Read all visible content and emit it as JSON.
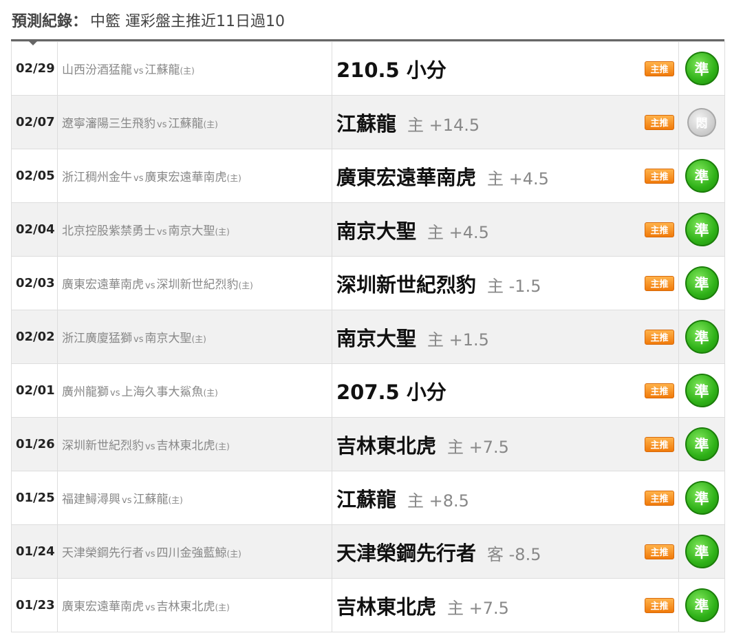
{
  "header": {
    "label": "預測紀錄",
    "colon": "：",
    "title": "中籃 運彩盤主推近11日過10"
  },
  "rows": [
    {
      "date": "02/29",
      "away": "山西汾酒猛龍",
      "vs": "vs",
      "home": "江蘇龍",
      "home_tag": "(主)",
      "pick": "210.5 小分",
      "spread": "",
      "badge": "主推",
      "result": "準",
      "result_type": "win"
    },
    {
      "date": "02/07",
      "away": "遼寧瀋陽三生飛豹",
      "vs": "vs",
      "home": "江蘇龍",
      "home_tag": "(主)",
      "pick": "江蘇龍",
      "spread": "主 +14.5",
      "badge": "主推",
      "result": "悶",
      "result_type": "push"
    },
    {
      "date": "02/05",
      "away": "浙江稠州金牛",
      "vs": "vs",
      "home": "廣東宏遠華南虎",
      "home_tag": "(主)",
      "pick": "廣東宏遠華南虎",
      "spread": "主 +4.5",
      "badge": "主推",
      "result": "準",
      "result_type": "win"
    },
    {
      "date": "02/04",
      "away": "北京控股紫禁勇士",
      "vs": "vs",
      "home": "南京大聖",
      "home_tag": "(主)",
      "pick": "南京大聖",
      "spread": "主 +4.5",
      "badge": "主推",
      "result": "準",
      "result_type": "win"
    },
    {
      "date": "02/03",
      "away": "廣東宏遠華南虎",
      "vs": "vs",
      "home": "深圳新世紀烈豹",
      "home_tag": "(主)",
      "pick": "深圳新世紀烈豹",
      "spread": "主 -1.5",
      "badge": "主推",
      "result": "準",
      "result_type": "win"
    },
    {
      "date": "02/02",
      "away": "浙江廣廈猛獅",
      "vs": "vs",
      "home": "南京大聖",
      "home_tag": "(主)",
      "pick": "南京大聖",
      "spread": "主 +1.5",
      "badge": "主推",
      "result": "準",
      "result_type": "win"
    },
    {
      "date": "02/01",
      "away": "廣州龍獅",
      "vs": "vs",
      "home": "上海久事大鯊魚",
      "home_tag": "(主)",
      "pick": "207.5 小分",
      "spread": "",
      "badge": "主推",
      "result": "準",
      "result_type": "win"
    },
    {
      "date": "01/26",
      "away": "深圳新世紀烈豹",
      "vs": "vs",
      "home": "吉林東北虎",
      "home_tag": "(主)",
      "pick": "吉林東北虎",
      "spread": "主 +7.5",
      "badge": "主推",
      "result": "準",
      "result_type": "win"
    },
    {
      "date": "01/25",
      "away": "福建鱘潯興",
      "vs": "vs",
      "home": "江蘇龍",
      "home_tag": "(主)",
      "pick": "江蘇龍",
      "spread": "主 +8.5",
      "badge": "主推",
      "result": "準",
      "result_type": "win"
    },
    {
      "date": "01/24",
      "away": "天津榮鋼先行者",
      "vs": "vs",
      "home": "四川金強藍鯨",
      "home_tag": "(主)",
      "pick": "天津榮鋼先行者",
      "spread": "客 -8.5",
      "badge": "主推",
      "result": "準",
      "result_type": "win"
    },
    {
      "date": "01/23",
      "away": "廣東宏遠華南虎",
      "vs": "vs",
      "home": "吉林東北虎",
      "home_tag": "(主)",
      "pick": "吉林東北虎",
      "spread": "主 +7.5",
      "badge": "主推",
      "result": "準",
      "result_type": "win"
    }
  ]
}
